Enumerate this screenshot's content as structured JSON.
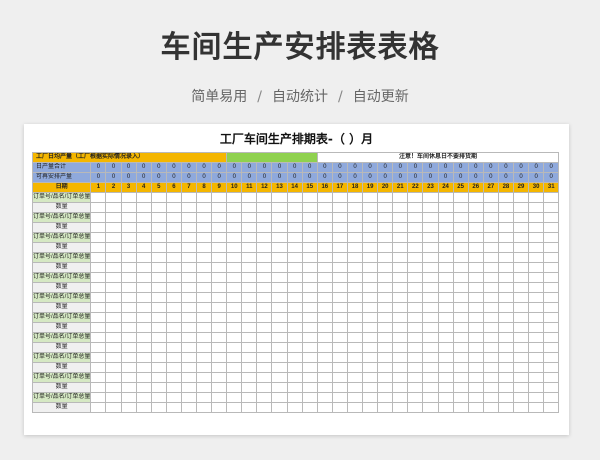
{
  "header": {
    "title": "车间生产安排表表格",
    "subtitle_parts": [
      "简单易用",
      "自动统计",
      "自动更新"
    ],
    "separator": "/"
  },
  "sheet": {
    "title": "工厂车间生产排期表-（      ）月",
    "avg_label": "工厂日均产量（工厂根据实际情况录入）",
    "note": "注意！车间休息日不要排货期",
    "daily_total_label": "日产量合计",
    "remaining_label": "可再安排产量",
    "date_label": "日期",
    "days": [
      "1",
      "2",
      "3",
      "4",
      "5",
      "6",
      "7",
      "8",
      "9",
      "10",
      "11",
      "12",
      "13",
      "14",
      "15",
      "16",
      "17",
      "18",
      "19",
      "20",
      "21",
      "22",
      "23",
      "24",
      "25",
      "26",
      "27",
      "28",
      "29",
      "30",
      "31"
    ],
    "daily_total_values": [
      "0",
      "0",
      "0",
      "0",
      "0",
      "0",
      "0",
      "0",
      "0",
      "0",
      "0",
      "0",
      "0",
      "0",
      "0",
      "0",
      "0",
      "0",
      "0",
      "0",
      "0",
      "0",
      "0",
      "0",
      "0",
      "0",
      "0",
      "0",
      "0",
      "0",
      "0"
    ],
    "remaining_values": [
      "0",
      "0",
      "0",
      "0",
      "0",
      "0",
      "0",
      "0",
      "0",
      "0",
      "0",
      "0",
      "0",
      "0",
      "0",
      "0",
      "0",
      "0",
      "0",
      "0",
      "0",
      "0",
      "0",
      "0",
      "0",
      "0",
      "0",
      "0",
      "0",
      "0",
      "0"
    ],
    "row_labels": [
      "订单号/品名/订单总量",
      "数量",
      "订单号/品名/订单总量",
      "数量",
      "订单号/品名/订单总量",
      "数量",
      "订单号/品名/订单总量",
      "数量",
      "订单号/品名/订单总量",
      "数量",
      "订单号/品名/订单总量",
      "数量",
      "订单号/品名/订单总量",
      "数量",
      "订单号/品名/订单总量",
      "数量",
      "订单号/品名/订单总量",
      "数量",
      "订单号/品名/订单总量",
      "数量",
      "订单号/品名/订单总量",
      "数量"
    ]
  },
  "colors": {
    "yellow": "#f4b600",
    "green": "#8fd14f",
    "blue": "#8fa9dc",
    "note_red": "#e0141e"
  }
}
